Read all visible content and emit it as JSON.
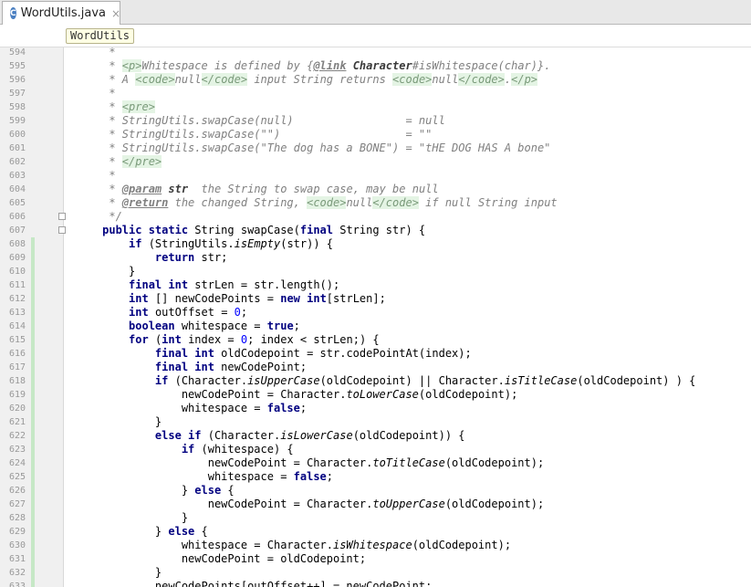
{
  "tab": {
    "icon_letter": "C",
    "title": "WordUtils.java",
    "close": "×"
  },
  "breadcrumb": "WordUtils",
  "lines": [
    {
      "n": "594",
      "chg": false,
      "fold": false,
      "segs": [
        [
          "cm",
          "      * "
        ]
      ]
    },
    {
      "n": "595",
      "chg": false,
      "fold": false,
      "segs": [
        [
          "cm",
          "      * "
        ],
        [
          "tg",
          "<p>"
        ],
        [
          "cm",
          "Whitespace is defined by {"
        ],
        [
          "jt",
          "@link"
        ],
        [
          "cm",
          " "
        ],
        [
          "jp",
          "Character"
        ],
        [
          "cm",
          "#isWhitespace(char)}."
        ]
      ]
    },
    {
      "n": "596",
      "chg": false,
      "fold": false,
      "segs": [
        [
          "cm",
          "      * A "
        ],
        [
          "tg",
          "<code>"
        ],
        [
          "cm",
          "null"
        ],
        [
          "tg",
          "</code>"
        ],
        [
          "cm",
          " input String returns "
        ],
        [
          "tg",
          "<code>"
        ],
        [
          "cm",
          "null"
        ],
        [
          "tg",
          "</code>"
        ],
        [
          "cm",
          "."
        ],
        [
          "tg",
          "</p>"
        ]
      ]
    },
    {
      "n": "597",
      "chg": false,
      "fold": false,
      "segs": [
        [
          "cm",
          "      *"
        ]
      ]
    },
    {
      "n": "598",
      "chg": false,
      "fold": false,
      "segs": [
        [
          "cm",
          "      * "
        ],
        [
          "tg",
          "<pre>"
        ]
      ]
    },
    {
      "n": "599",
      "chg": false,
      "fold": false,
      "segs": [
        [
          "cm",
          "      * StringUtils.swapCase(null)                 = null"
        ]
      ]
    },
    {
      "n": "600",
      "chg": false,
      "fold": false,
      "segs": [
        [
          "cm",
          "      * StringUtils.swapCase(\"\")                   = \"\""
        ]
      ]
    },
    {
      "n": "601",
      "chg": false,
      "fold": false,
      "segs": [
        [
          "cm",
          "      * StringUtils.swapCase(\"The dog has a BONE\") = \"tHE DOG HAS A bone\""
        ]
      ]
    },
    {
      "n": "602",
      "chg": false,
      "fold": false,
      "segs": [
        [
          "cm",
          "      * "
        ],
        [
          "tg",
          "</pre>"
        ]
      ]
    },
    {
      "n": "603",
      "chg": false,
      "fold": false,
      "segs": [
        [
          "cm",
          "      *"
        ]
      ]
    },
    {
      "n": "604",
      "chg": false,
      "fold": false,
      "segs": [
        [
          "cm",
          "      * "
        ],
        [
          "jt",
          "@param"
        ],
        [
          "cm",
          " "
        ],
        [
          "jp",
          "str"
        ],
        [
          "cm",
          "  the String to swap case, may be null"
        ]
      ]
    },
    {
      "n": "605",
      "chg": false,
      "fold": false,
      "segs": [
        [
          "cm",
          "      * "
        ],
        [
          "jt",
          "@return"
        ],
        [
          "cm",
          " the changed String, "
        ],
        [
          "tg",
          "<code>"
        ],
        [
          "cm",
          "null"
        ],
        [
          "tg",
          "</code>"
        ],
        [
          "cm",
          " if null String input"
        ]
      ]
    },
    {
      "n": "606",
      "chg": false,
      "fold": true,
      "segs": [
        [
          "cm",
          "      */"
        ]
      ]
    },
    {
      "n": "607",
      "chg": false,
      "fold": true,
      "segs": [
        [
          "",
          "     "
        ],
        [
          "kw",
          "public static"
        ],
        [
          "",
          " String swapCase("
        ],
        [
          "kw",
          "final"
        ],
        [
          "",
          " String str) {"
        ]
      ]
    },
    {
      "n": "608",
      "chg": true,
      "fold": false,
      "segs": [
        [
          "",
          "         "
        ],
        [
          "kw",
          "if"
        ],
        [
          "",
          " (StringUtils."
        ],
        [
          "st",
          "isEmpty"
        ],
        [
          "",
          "(str)) {"
        ]
      ]
    },
    {
      "n": "609",
      "chg": true,
      "fold": false,
      "segs": [
        [
          "",
          "             "
        ],
        [
          "kw",
          "return"
        ],
        [
          "",
          " str;"
        ]
      ]
    },
    {
      "n": "610",
      "chg": true,
      "fold": false,
      "segs": [
        [
          "",
          "         }"
        ]
      ]
    },
    {
      "n": "611",
      "chg": true,
      "fold": false,
      "segs": [
        [
          "",
          "         "
        ],
        [
          "kw",
          "final int"
        ],
        [
          "",
          " strLen = str.length();"
        ]
      ]
    },
    {
      "n": "612",
      "chg": true,
      "fold": false,
      "segs": [
        [
          "",
          "         "
        ],
        [
          "kw",
          "int"
        ],
        [
          "",
          " [] newCodePoints = "
        ],
        [
          "kw",
          "new int"
        ],
        [
          "",
          "[strLen];"
        ]
      ]
    },
    {
      "n": "613",
      "chg": true,
      "fold": false,
      "segs": [
        [
          "",
          "         "
        ],
        [
          "kw",
          "int"
        ],
        [
          "",
          " outOffset = "
        ],
        [
          "num",
          "0"
        ],
        [
          "",
          ";"
        ]
      ]
    },
    {
      "n": "614",
      "chg": true,
      "fold": false,
      "segs": [
        [
          "",
          "         "
        ],
        [
          "kw",
          "boolean"
        ],
        [
          "",
          " whitespace = "
        ],
        [
          "kw",
          "true"
        ],
        [
          "",
          ";"
        ]
      ]
    },
    {
      "n": "615",
      "chg": true,
      "fold": false,
      "segs": [
        [
          "",
          "         "
        ],
        [
          "kw",
          "for"
        ],
        [
          "",
          " ("
        ],
        [
          "kw",
          "int"
        ],
        [
          "",
          " index = "
        ],
        [
          "num",
          "0"
        ],
        [
          "",
          "; index < strLen;) {"
        ]
      ]
    },
    {
      "n": "616",
      "chg": true,
      "fold": false,
      "segs": [
        [
          "",
          "             "
        ],
        [
          "kw",
          "final int"
        ],
        [
          "",
          " oldCodepoint = str.codePointAt(index);"
        ]
      ]
    },
    {
      "n": "617",
      "chg": true,
      "fold": false,
      "segs": [
        [
          "",
          "             "
        ],
        [
          "kw",
          "final int"
        ],
        [
          "",
          " newCodePoint;"
        ]
      ]
    },
    {
      "n": "618",
      "chg": true,
      "fold": false,
      "segs": [
        [
          "",
          "             "
        ],
        [
          "kw",
          "if"
        ],
        [
          "",
          " (Character."
        ],
        [
          "st",
          "isUpperCase"
        ],
        [
          "",
          "(oldCodepoint) || Character."
        ],
        [
          "st",
          "isTitleCase"
        ],
        [
          "",
          "(oldCodepoint) ) {"
        ]
      ]
    },
    {
      "n": "619",
      "chg": true,
      "fold": false,
      "segs": [
        [
          "",
          "                 newCodePoint = Character."
        ],
        [
          "st",
          "toLowerCase"
        ],
        [
          "",
          "(oldCodepoint);"
        ]
      ]
    },
    {
      "n": "620",
      "chg": true,
      "fold": false,
      "segs": [
        [
          "",
          "                 whitespace = "
        ],
        [
          "kw",
          "false"
        ],
        [
          "",
          ";"
        ]
      ]
    },
    {
      "n": "621",
      "chg": true,
      "fold": false,
      "segs": [
        [
          "",
          "             }"
        ]
      ]
    },
    {
      "n": "622",
      "chg": true,
      "fold": false,
      "segs": [
        [
          "",
          "             "
        ],
        [
          "kw",
          "else if"
        ],
        [
          "",
          " (Character."
        ],
        [
          "st",
          "isLowerCase"
        ],
        [
          "",
          "(oldCodepoint)) {"
        ]
      ]
    },
    {
      "n": "623",
      "chg": true,
      "fold": false,
      "segs": [
        [
          "",
          "                 "
        ],
        [
          "kw",
          "if"
        ],
        [
          "",
          " (whitespace) {"
        ]
      ]
    },
    {
      "n": "624",
      "chg": true,
      "fold": false,
      "segs": [
        [
          "",
          "                     newCodePoint = Character."
        ],
        [
          "st",
          "toTitleCase"
        ],
        [
          "",
          "(oldCodepoint);"
        ]
      ]
    },
    {
      "n": "625",
      "chg": true,
      "fold": false,
      "segs": [
        [
          "",
          "                     whitespace = "
        ],
        [
          "kw",
          "false"
        ],
        [
          "",
          ";"
        ]
      ]
    },
    {
      "n": "626",
      "chg": true,
      "fold": false,
      "segs": [
        [
          "",
          "                 } "
        ],
        [
          "kw",
          "else"
        ],
        [
          "",
          " {"
        ]
      ]
    },
    {
      "n": "627",
      "chg": true,
      "fold": false,
      "segs": [
        [
          "",
          "                     newCodePoint = Character."
        ],
        [
          "st",
          "toUpperCase"
        ],
        [
          "",
          "(oldCodepoint);"
        ]
      ]
    },
    {
      "n": "628",
      "chg": true,
      "fold": false,
      "segs": [
        [
          "",
          "                 }"
        ]
      ]
    },
    {
      "n": "629",
      "chg": true,
      "fold": false,
      "segs": [
        [
          "",
          "             } "
        ],
        [
          "kw",
          "else"
        ],
        [
          "",
          " {"
        ]
      ]
    },
    {
      "n": "630",
      "chg": true,
      "fold": false,
      "segs": [
        [
          "",
          "                 whitespace = Character."
        ],
        [
          "st",
          "isWhitespace"
        ],
        [
          "",
          "(oldCodepoint);"
        ]
      ]
    },
    {
      "n": "631",
      "chg": true,
      "fold": false,
      "segs": [
        [
          "",
          "                 newCodePoint = oldCodepoint;"
        ]
      ]
    },
    {
      "n": "632",
      "chg": true,
      "fold": false,
      "segs": [
        [
          "",
          "             }"
        ]
      ]
    },
    {
      "n": "633",
      "chg": true,
      "fold": false,
      "segs": [
        [
          "",
          "             newCodePoints[outOffset++] = newCodePoint;"
        ]
      ]
    }
  ]
}
